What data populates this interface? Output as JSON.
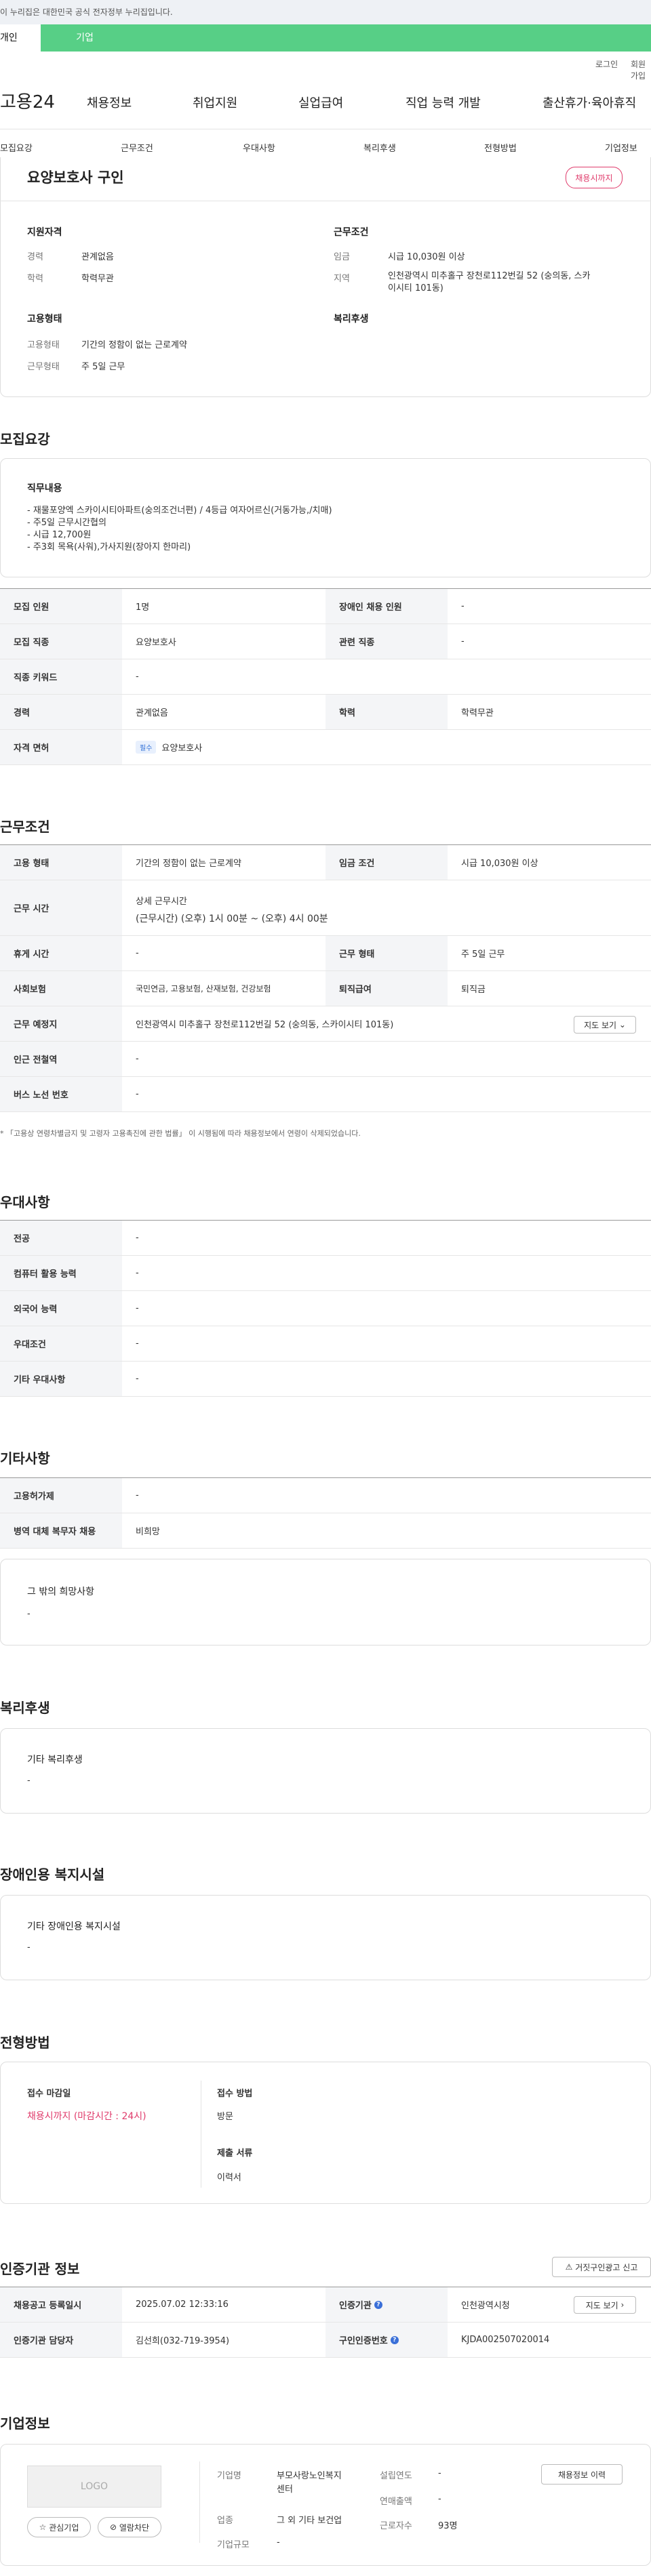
{
  "header": {
    "gov_notice": "이 누리집은 대한민국 공식 전자정부 누리집입니다.",
    "tab_person": "개인",
    "tab_company": "기업",
    "login": "로그인",
    "join": "회원가입",
    "logo": "고용24",
    "gnb": [
      "채용정보",
      "취업지원",
      "실업급여",
      "직업 능력 개발",
      "출산휴가·육아휴직"
    ]
  },
  "subnav": [
    "모집요강",
    "근무조건",
    "우대사항",
    "복리후생",
    "전형방법",
    "기업정보"
  ],
  "title": {
    "text": "요양보호사 구인",
    "badge": "채용시까지"
  },
  "summary": {
    "qual_title": "지원자격",
    "career_l": "경력",
    "career_v": "관계없음",
    "edu_l": "학력",
    "edu_v": "학력무관",
    "emp_title": "고용형태",
    "emptype_l": "고용형태",
    "emptype_v": "기간의 정함이 없는 근로계약",
    "workform_l": "근무형태",
    "workform_v": "주 5일 근무",
    "cond_title": "근무조건",
    "wage_l": "임금",
    "wage_v": "시급 10,030원 이상",
    "region_l": "지역",
    "region_v1": "인천광역시 미추홀구 장천로112번길 52 (숭의동, 스카",
    "region_v2": "이시티 101동)",
    "welfare_title": "복리후생"
  },
  "recruit": {
    "title": "모집요강",
    "duty_title": "직무내용",
    "duty_lines": [
      "- 재물포양엑 스카이시티아파트(숭의조건너편) / 4등급 여자어르신(거동가능,/치매)",
      "- 주5일 근무시간협의",
      "- 시급 12,700원",
      "- 주3회 목욕(사워),가사지원(장아지 한마리)"
    ],
    "r1": [
      "모집 인원",
      "1명",
      "장애인 채용 인원",
      "-"
    ],
    "r2": [
      "모집 직종",
      "요양보호사",
      "관련 직종",
      "-"
    ],
    "r3": [
      "직종 키워드",
      "-"
    ],
    "r4": [
      "경력",
      "관계없음",
      "학력",
      "학력무관"
    ],
    "r5": [
      "자격 면허",
      "필수",
      "요양보호사"
    ]
  },
  "work": {
    "title": "근무조건",
    "r1": [
      "고용 형태",
      "기간의 정함이 없는 근로계약",
      "임금 조건",
      "시급 10,030원 이상"
    ],
    "r2": [
      "근무 시간",
      "상세 근무시간",
      "(근무시간) (오후) 1시 00분 ~ (오후) 4시 00분"
    ],
    "r3": [
      "휴게 시간",
      "-",
      "근무 형태",
      "주 5일 근무"
    ],
    "r4": [
      "사회보험",
      "국민연금, 고용보험, 산재보험, 건강보험",
      "퇴직급여",
      "퇴직금"
    ],
    "r5": [
      "근무 예정지",
      "인천광역시 미추홀구 장천로112번길 52 (숭의동, 스카이시티 101동)",
      "지도 보기"
    ],
    "r6": [
      "인근 전철역",
      "-"
    ],
    "r7": [
      "버스 노선 번호",
      "-"
    ],
    "note": "* 「고용상 연령차별금지 및 고령자 고용촉진에 관한 법률」 이 시행됨에 따라 채용정보에서 연령이 삭제되었습니다."
  },
  "pref": {
    "title": "우대사항",
    "rows": [
      [
        "전공",
        "-"
      ],
      [
        "컴퓨터 활용 능력",
        "-"
      ],
      [
        "외국어 능력",
        "-"
      ],
      [
        "우대조건",
        "-"
      ],
      [
        "기타 우대사항",
        "-"
      ]
    ]
  },
  "etc": {
    "title": "기타사항",
    "rows": [
      [
        "고용허가제",
        "-"
      ],
      [
        "병역 대체 복무자 채용",
        "비희망"
      ]
    ],
    "box_title": "그 밖의 희망사항",
    "box_val": "-"
  },
  "welfare": {
    "title": "복리후생",
    "box_title": "기타 복리후생",
    "box_val": "-"
  },
  "disab": {
    "title": "장애인용 복지시설",
    "box_title": "기타 장애인용 복지시설",
    "box_val": "-"
  },
  "process": {
    "title": "전형방법",
    "deadline_l": "접수 마감일",
    "deadline_v": "채용시까지 (마감시간 : 24시)",
    "method_l": "접수 방법",
    "method_v": "방문",
    "docs_l": "제출 서류",
    "docs_v": "이력서"
  },
  "cert": {
    "title": "인증기관 정보",
    "report": "거짓구인광고 신고",
    "r1": [
      "채용공고 등록일시",
      "2025.07.02 12:33:16",
      "인증기관",
      "인천광역시청",
      "지도 보기"
    ],
    "r2": [
      "인증기관 담당자",
      "김선희(032-719-3954)",
      "구인인증번호",
      "KJDA002507020014"
    ]
  },
  "company": {
    "title": "기업정보",
    "logo": "LOGO",
    "fav": "관심기업",
    "block": "열람차단",
    "name_l": "기업명",
    "name_v1": "부모사랑노인복지",
    "name_v2": "센터",
    "ind_l": "업종",
    "ind_v": "그 외 기타 보건업",
    "size_l": "기업규모",
    "size_v": "-",
    "est_l": "설립연도",
    "est_v": "-",
    "rev_l": "연매출액",
    "rev_v": "-",
    "emp_l": "근로자수",
    "emp_v": "93명",
    "history": "채용정보 이력"
  },
  "colors": {
    "green": "#57cf86",
    "pink": "#e03c6c"
  }
}
